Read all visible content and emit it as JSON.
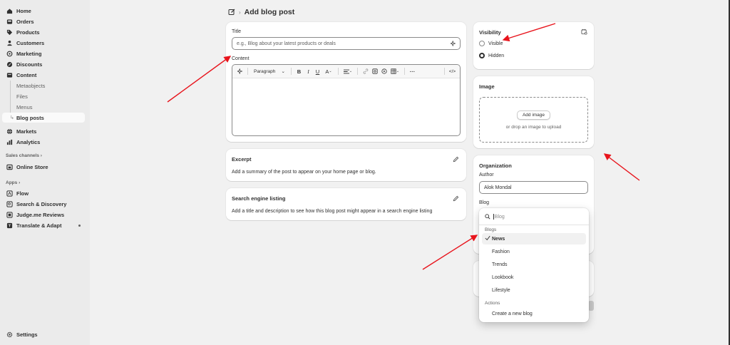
{
  "sidebar": {
    "items": [
      {
        "label": "Home"
      },
      {
        "label": "Orders"
      },
      {
        "label": "Products"
      },
      {
        "label": "Customers"
      },
      {
        "label": "Marketing"
      },
      {
        "label": "Discounts"
      },
      {
        "label": "Content"
      }
    ],
    "content_sub": [
      {
        "label": "Metaobjects"
      },
      {
        "label": "Files"
      },
      {
        "label": "Menus"
      },
      {
        "label": "Blog posts"
      }
    ],
    "items2": [
      {
        "label": "Markets"
      },
      {
        "label": "Analytics"
      }
    ],
    "sales_channels_label": "Sales channels",
    "online_store": "Online Store",
    "apps_label": "Apps",
    "apps": [
      {
        "label": "Flow"
      },
      {
        "label": "Search & Discovery"
      },
      {
        "label": "Judge.me Reviews"
      },
      {
        "label": "Translate & Adapt"
      }
    ],
    "settings": "Settings"
  },
  "header": {
    "title": "Add blog post"
  },
  "post_card": {
    "title_label": "Title",
    "title_placeholder": "e.g., Blog about your latest products or deals",
    "content_label": "Content",
    "format_select": "Paragraph"
  },
  "excerpt": {
    "title": "Excerpt",
    "description": "Add a summary of the post to appear on your home page or blog."
  },
  "seo": {
    "title": "Search engine listing",
    "description": "Add a title and description to see how this blog post might appear in a search engine listing"
  },
  "visibility": {
    "title": "Visibility",
    "options": [
      {
        "label": "Visible",
        "selected": false
      },
      {
        "label": "Hidden",
        "selected": true
      }
    ]
  },
  "image": {
    "title": "Image",
    "add_button": "Add image",
    "hint": "or drop an image to upload"
  },
  "organization": {
    "title": "Organization",
    "author_label": "Author",
    "author_value": "Alok Mondal",
    "blog_label": "Blog"
  },
  "blog_dropdown": {
    "search_placeholder": "Blog",
    "group_label": "Blogs",
    "options": [
      {
        "label": "News",
        "selected": true
      },
      {
        "label": "Fashion",
        "selected": false
      },
      {
        "label": "Trends",
        "selected": false
      },
      {
        "label": "Lookbook",
        "selected": false
      },
      {
        "label": "Lifestyle",
        "selected": false
      }
    ],
    "actions_label": "Actions",
    "create_action": "Create a new blog"
  },
  "colors": {
    "annotation_arrow": "#e8141c",
    "sidebar_bg": "#ebebeb",
    "page_bg": "#f1f1f1"
  }
}
